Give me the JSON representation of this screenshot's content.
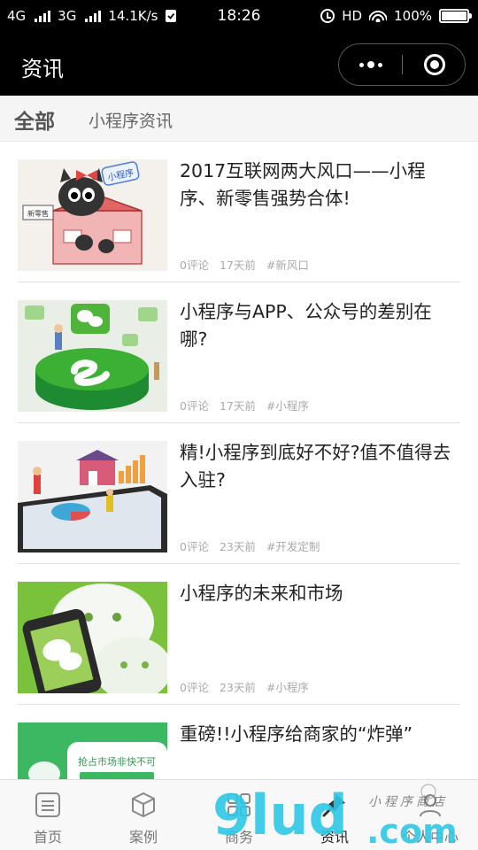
{
  "status_bar": {
    "network1": "4G",
    "network2": "3G",
    "speed": "14.1K/s",
    "time": "18:26",
    "hd": "HD",
    "battery": "100%"
  },
  "nav": {
    "title": "资讯"
  },
  "tabs": {
    "all": "全部",
    "mini": "小程序资讯"
  },
  "articles": [
    {
      "title": "2017互联网两大风口——小程序、新零售强势合体!",
      "comments": "0评论",
      "time": "17天前",
      "tag": "#新风口"
    },
    {
      "title": "小程序与APP、公众号的差别在哪?",
      "comments": "0评论",
      "time": "17天前",
      "tag": "#小程序"
    },
    {
      "title": "精!小程序到底好不好?值不值得去入驻?",
      "comments": "0评论",
      "time": "23天前",
      "tag": "#开发定制"
    },
    {
      "title": "小程序的未来和市场",
      "comments": "0评论",
      "time": "23天前",
      "tag": "#小程序"
    },
    {
      "title": "重磅!!小程序给商家的“炸弹”",
      "comments": "",
      "time": "",
      "tag": ""
    }
  ],
  "thumb_text": {
    "t1_badge": "小程序",
    "t1_sign": "新零售",
    "t5_line": "抢占市场非快不可"
  },
  "tabbar": [
    {
      "label": "首页",
      "icon": "home-icon"
    },
    {
      "label": "案例",
      "icon": "cube-icon"
    },
    {
      "label": "商务",
      "icon": "grid-icon"
    },
    {
      "label": "资讯",
      "icon": "pin-icon"
    },
    {
      "label": "个人中心",
      "icon": "person-icon"
    }
  ],
  "watermark": {
    "logo": "9lud",
    "domain": ".com",
    "script": "小程序商店"
  },
  "colors": {
    "wechat_green": "#3cb034",
    "watermark_cyan": "#2cc6e4",
    "text": "#222222",
    "meta": "#aaaaaa"
  }
}
